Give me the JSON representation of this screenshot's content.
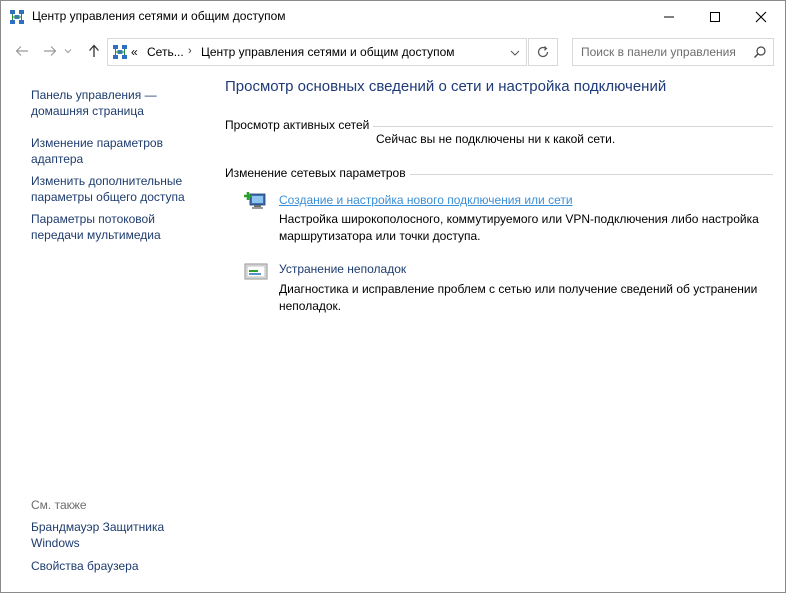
{
  "window": {
    "title": "Центр управления сетями и общим доступом"
  },
  "addressbar": {
    "overflow": "«",
    "crumbs": [
      "Сеть...",
      "Центр управления сетями и общим доступом"
    ]
  },
  "search": {
    "placeholder": "Поиск в панели управления"
  },
  "sidebar": {
    "home_link_line1": "Панель управления —",
    "home_link_line2": "домашняя страница",
    "items": [
      {
        "line1": "Изменение параметров",
        "line2": "адаптера"
      },
      {
        "line1": "Изменить дополнительные",
        "line2": "параметры общего доступа"
      },
      {
        "line1": "Параметры потоковой",
        "line2": "передачи мультимедиа"
      }
    ],
    "see_also_label": "См. также",
    "see_also": [
      {
        "line1": "Брандмауэр Защитника",
        "line2": "Windows"
      },
      {
        "line1": "Свойства браузера",
        "line2": ""
      }
    ]
  },
  "main": {
    "title": "Просмотр основных сведений о сети и настройка подключений",
    "active_networks_label": "Просмотр активных сетей",
    "no_connection_text": "Сейчас вы не подключены ни к какой сети.",
    "change_settings_label": "Изменение сетевых параметров",
    "tasks": [
      {
        "link": "Создание и настройка нового подключения или сети",
        "desc_line1": "Настройка широкополосного, коммутируемого или VPN-подключения либо настройка",
        "desc_line2": "маршрутизатора или точки доступа."
      },
      {
        "link": "Устранение неполадок",
        "desc_line1": "Диагностика и исправление проблем с сетью или получение сведений об устранении",
        "desc_line2": "неполадок."
      }
    ]
  },
  "colors": {
    "link": "#1e3c6e",
    "link_hover": "#3a8fd6",
    "title": "#1e3a78"
  }
}
